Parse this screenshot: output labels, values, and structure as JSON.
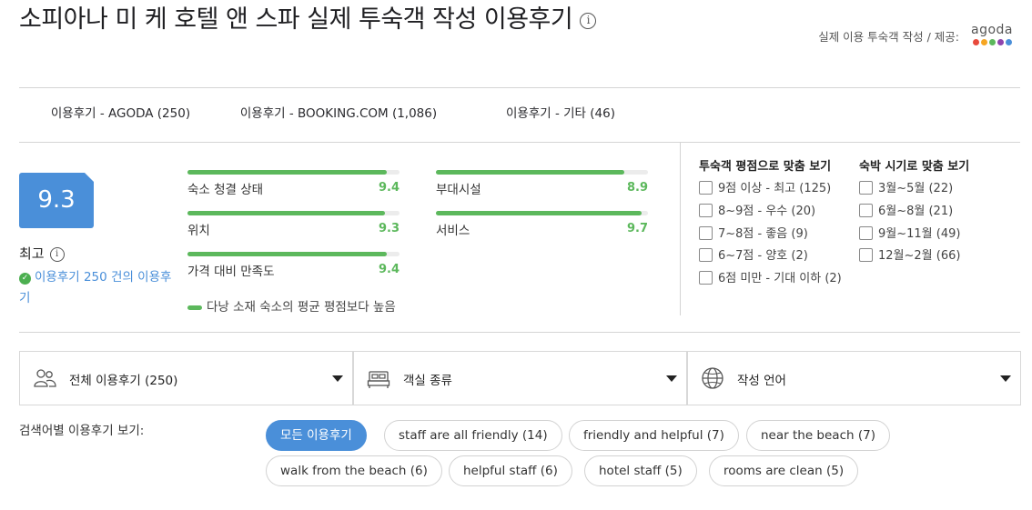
{
  "header": {
    "title": "소피아나 미 케 호텔 앤 스파 실제 투숙객 작성 이용후기",
    "info_glyph": "i",
    "provider_label": "실제 이용 투숙객 작성 / 제공:",
    "provider_logo_text": "agoda",
    "logo_colors": [
      "#e84a3c",
      "#f6a623",
      "#5cb85c",
      "#8e44ad",
      "#4a8fd9"
    ]
  },
  "tabs": [
    {
      "label": "이용후기 - AGODA (250)",
      "active": true
    },
    {
      "label": "이용후기 - BOOKING.COM (1,086)",
      "active": false
    },
    {
      "label": "이용후기 - 기타 (46)",
      "active": false
    }
  ],
  "score": {
    "value": "9.3",
    "word": "최고",
    "info_glyph": "i",
    "review_count_text": "이용후기 250 건의 이용후기"
  },
  "categories": [
    {
      "label": "숙소 청결 상태",
      "value": "9.4",
      "score": 9.4
    },
    {
      "label": "부대시설",
      "value": "8.9",
      "score": 8.9
    },
    {
      "label": "위치",
      "value": "9.3",
      "score": 9.3
    },
    {
      "label": "서비스",
      "value": "9.7",
      "score": 9.7
    },
    {
      "label": "가격 대비 만족도",
      "value": "9.4",
      "score": 9.4
    }
  ],
  "legend_text": "다낭 소재 숙소의 평균 평점보다 높음",
  "colors": {
    "accent": "#4a8fd9",
    "good": "#5cb85c"
  },
  "filters": {
    "rating_heading": "투숙객 평점으로 맞춤 보기",
    "rating_options": [
      "9점 이상 - 최고 (125)",
      "8~9점 - 우수 (20)",
      "7~8점 - 좋음 (9)",
      "6~7점 - 양호 (2)",
      "6점 미만 - 기대 이하 (2)"
    ],
    "season_heading": "숙박 시기로 맞춤 보기",
    "season_options": [
      "3월~5월 (22)",
      "6월~8월 (21)",
      "9월~11월 (49)",
      "12월~2월 (66)"
    ]
  },
  "dropdowns": [
    {
      "label": "전체 이용후기 (250)",
      "icon": "people-icon"
    },
    {
      "label": "객실 종류",
      "icon": "bed-icon"
    },
    {
      "label": "작성 언어",
      "icon": "globe-icon"
    }
  ],
  "search": {
    "label": "검색어별 이용후기 보기:",
    "chips": [
      {
        "label": "모든 이용후기",
        "active": true
      },
      {
        "label": "staff are all friendly (14)",
        "active": false
      },
      {
        "label": "friendly and helpful (7)",
        "active": false
      },
      {
        "label": "near the beach (7)",
        "active": false
      },
      {
        "label": "walk from the beach (6)",
        "active": false
      },
      {
        "label": "helpful staff (6)",
        "active": false
      },
      {
        "label": "hotel staff (5)",
        "active": false
      },
      {
        "label": "rooms are clean (5)",
        "active": false
      }
    ]
  }
}
